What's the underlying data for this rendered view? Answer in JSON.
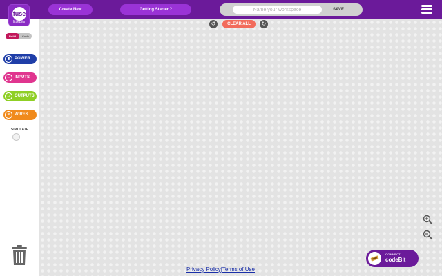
{
  "header": {
    "logo_text": "fuse",
    "logo_subtext": "littleBits",
    "create_new_label": "Create New",
    "getting_started_label": "Getting Started?",
    "workspace_placeholder": "Name your workspace",
    "save_label": "SAVE"
  },
  "sidebar": {
    "mode_build": "Build",
    "mode_code": "Code",
    "categories": [
      {
        "label": "POWER",
        "color": "#1f3ea8",
        "icon": "battery-icon"
      },
      {
        "label": "INPUTS",
        "color": "#e0358f",
        "icon": "input-arrow-icon"
      },
      {
        "label": "OUTPUTS",
        "color": "#8fcf25",
        "icon": "output-arrow-icon"
      },
      {
        "label": "WIRES",
        "color": "#f08a1c",
        "icon": "wire-icon"
      }
    ],
    "simulate_label": "SIMULATE"
  },
  "toolbar": {
    "clear_all_label": "CLEAR ALL"
  },
  "connect": {
    "top_label": "CONNECT",
    "main_label": "codeBit"
  },
  "footer": {
    "privacy_label": "Privacy Policy",
    "separator": "|",
    "terms_label": "Terms of Use"
  },
  "colors": {
    "brand_purple": "#6b1a9a",
    "pill_purple": "#9a33d6",
    "clear_red": "#f26b5b",
    "build_magenta": "#c2185b"
  }
}
